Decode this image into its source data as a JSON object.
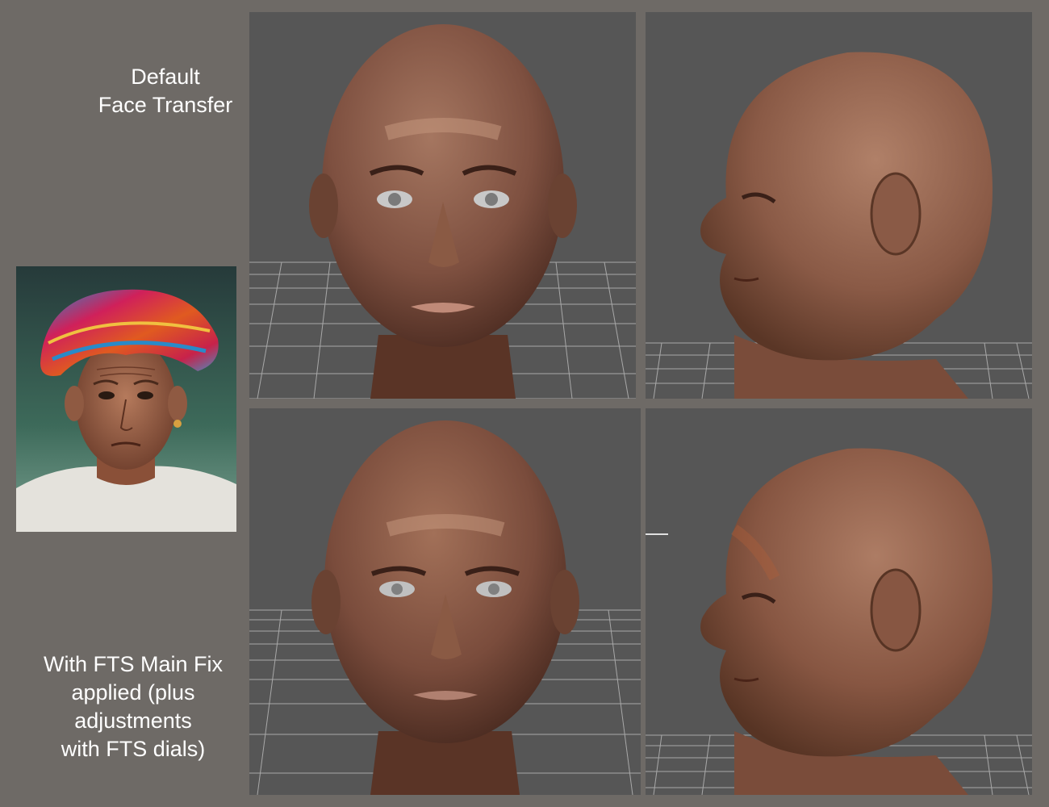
{
  "captions": {
    "default": "Default\nFace Transfer",
    "fixed": "With FTS Main Fix\napplied (plus\nadjustments\nwith FTS dials)"
  },
  "colors": {
    "background": "#6e6a66",
    "viewport": "#565656",
    "grid": "#bdbdbd",
    "skin": "#9a6a52",
    "turban_red": "#c8224a",
    "turban_blue": "#2a8ac8"
  },
  "panels": [
    {
      "view": "front",
      "row": "default"
    },
    {
      "view": "side",
      "row": "default"
    },
    {
      "view": "front",
      "row": "fixed"
    },
    {
      "view": "side",
      "row": "fixed"
    }
  ]
}
